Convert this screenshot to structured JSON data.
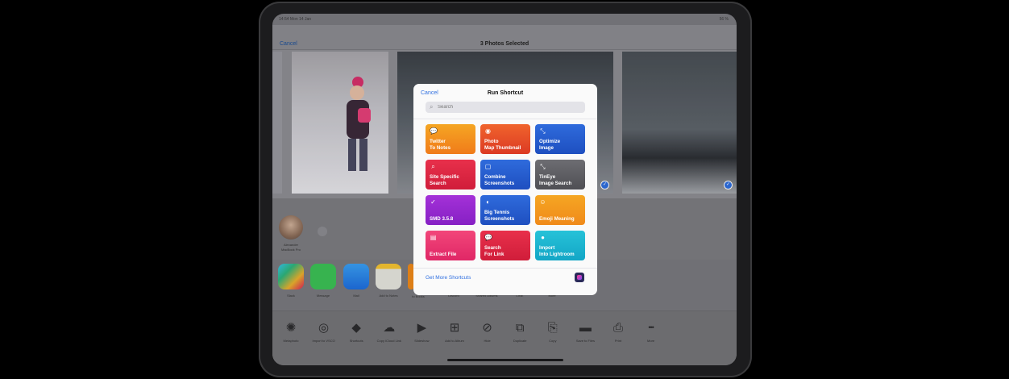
{
  "status": {
    "time": "14:54  Mon 14 Jan",
    "battery": "56 %"
  },
  "nav": {
    "cancel": "Cancel",
    "title": "3 Photos Selected"
  },
  "airdrop": {
    "person_name": "Alexander",
    "person_device": "MacBook Pro"
  },
  "apps": [
    {
      "label": "Slack"
    },
    {
      "label": "Message"
    },
    {
      "label": "Mail"
    },
    {
      "label": "Add to Notes"
    },
    {
      "label": "to Books"
    },
    {
      "label": "Discord"
    },
    {
      "label": "Shared Albums"
    },
    {
      "label": "LINE"
    },
    {
      "label": "More"
    }
  ],
  "actions": [
    {
      "label": "Metaphoto",
      "icon": "star-icon"
    },
    {
      "label": "Import to VSCO",
      "icon": "vsco-icon"
    },
    {
      "label": "Shortcuts",
      "icon": "layers-icon"
    },
    {
      "label": "Copy iCloud Link",
      "icon": "cloud-icon"
    },
    {
      "label": "Slideshow",
      "icon": "play-icon"
    },
    {
      "label": "Add to Album",
      "icon": "album-icon"
    },
    {
      "label": "Hide",
      "icon": "hide-icon"
    },
    {
      "label": "Duplicate",
      "icon": "duplicate-icon"
    },
    {
      "label": "Copy",
      "icon": "copy-icon"
    },
    {
      "label": "Save to Files",
      "icon": "folder-icon"
    },
    {
      "label": "Print",
      "icon": "printer-icon"
    },
    {
      "label": "More",
      "icon": "more-icon"
    }
  ],
  "sheet": {
    "cancel": "Cancel",
    "title": "Run Shortcut",
    "search_placeholder": "Search",
    "get_more": "Get More Shortcuts",
    "tiles": [
      {
        "label": "Twitter\nTo Notes",
        "icon": "speech-bubble-icon",
        "color1": "#f5a623",
        "color2": "#f07b1a"
      },
      {
        "label": "Photo\nMap Thumbnail",
        "icon": "camera-icon",
        "color1": "#f0642c",
        "color2": "#dc3a24"
      },
      {
        "label": "Optimize\nImage",
        "icon": "compress-icon",
        "color1": "#2f6bdc",
        "color2": "#1e4fc0"
      },
      {
        "label": "Site Specific\nSearch",
        "icon": "magnifier-icon",
        "color1": "#e8304b",
        "color2": "#d01d3a"
      },
      {
        "label": "Combine\nScreenshots",
        "icon": "square-icon",
        "color1": "#2f6bdc",
        "color2": "#1e4fc0"
      },
      {
        "label": "TinEye\nImage Search",
        "icon": "compress-icon",
        "color1": "#6d6d72",
        "color2": "#4f4f54"
      },
      {
        "label": "SMD 3.5.8",
        "icon": "checkmark-icon",
        "color1": "#a431d8",
        "color2": "#8620c4"
      },
      {
        "label": "Big Tennis\nScreenshots",
        "icon": "tennis-ball-icon",
        "color1": "#2f6bdc",
        "color2": "#1e4fc0"
      },
      {
        "label": "Emoji Meaning",
        "icon": "smiley-icon",
        "color1": "#f5a623",
        "color2": "#f08a1a"
      },
      {
        "label": "Extract File",
        "icon": "document-icon",
        "color1": "#f2467a",
        "color2": "#e02766"
      },
      {
        "label": "Search\nFor Link",
        "icon": "speech-bubble-icon",
        "color1": "#e8304b",
        "color2": "#d01d3a"
      },
      {
        "label": "Import\nInto Lightroom",
        "icon": "lightbulb-icon",
        "color1": "#26c2d8",
        "color2": "#13a6c6"
      }
    ]
  }
}
